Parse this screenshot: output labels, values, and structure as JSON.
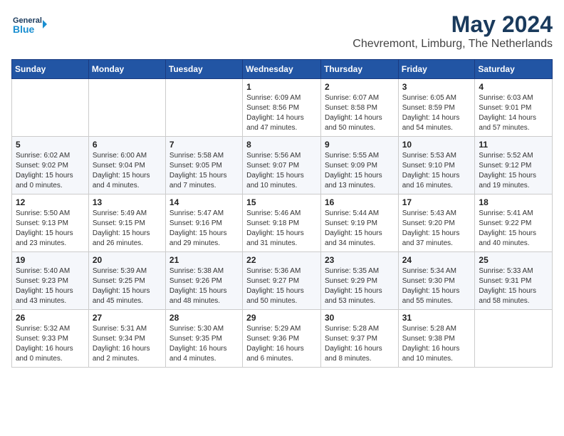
{
  "header": {
    "logo_line1": "General",
    "logo_line2": "Blue",
    "month": "May 2024",
    "location": "Chevremont, Limburg, The Netherlands"
  },
  "weekdays": [
    "Sunday",
    "Monday",
    "Tuesday",
    "Wednesday",
    "Thursday",
    "Friday",
    "Saturday"
  ],
  "weeks": [
    [
      {
        "day": "",
        "detail": ""
      },
      {
        "day": "",
        "detail": ""
      },
      {
        "day": "",
        "detail": ""
      },
      {
        "day": "1",
        "detail": "Sunrise: 6:09 AM\nSunset: 8:56 PM\nDaylight: 14 hours\nand 47 minutes."
      },
      {
        "day": "2",
        "detail": "Sunrise: 6:07 AM\nSunset: 8:58 PM\nDaylight: 14 hours\nand 50 minutes."
      },
      {
        "day": "3",
        "detail": "Sunrise: 6:05 AM\nSunset: 8:59 PM\nDaylight: 14 hours\nand 54 minutes."
      },
      {
        "day": "4",
        "detail": "Sunrise: 6:03 AM\nSunset: 9:01 PM\nDaylight: 14 hours\nand 57 minutes."
      }
    ],
    [
      {
        "day": "5",
        "detail": "Sunrise: 6:02 AM\nSunset: 9:02 PM\nDaylight: 15 hours\nand 0 minutes."
      },
      {
        "day": "6",
        "detail": "Sunrise: 6:00 AM\nSunset: 9:04 PM\nDaylight: 15 hours\nand 4 minutes."
      },
      {
        "day": "7",
        "detail": "Sunrise: 5:58 AM\nSunset: 9:05 PM\nDaylight: 15 hours\nand 7 minutes."
      },
      {
        "day": "8",
        "detail": "Sunrise: 5:56 AM\nSunset: 9:07 PM\nDaylight: 15 hours\nand 10 minutes."
      },
      {
        "day": "9",
        "detail": "Sunrise: 5:55 AM\nSunset: 9:09 PM\nDaylight: 15 hours\nand 13 minutes."
      },
      {
        "day": "10",
        "detail": "Sunrise: 5:53 AM\nSunset: 9:10 PM\nDaylight: 15 hours\nand 16 minutes."
      },
      {
        "day": "11",
        "detail": "Sunrise: 5:52 AM\nSunset: 9:12 PM\nDaylight: 15 hours\nand 19 minutes."
      }
    ],
    [
      {
        "day": "12",
        "detail": "Sunrise: 5:50 AM\nSunset: 9:13 PM\nDaylight: 15 hours\nand 23 minutes."
      },
      {
        "day": "13",
        "detail": "Sunrise: 5:49 AM\nSunset: 9:15 PM\nDaylight: 15 hours\nand 26 minutes."
      },
      {
        "day": "14",
        "detail": "Sunrise: 5:47 AM\nSunset: 9:16 PM\nDaylight: 15 hours\nand 29 minutes."
      },
      {
        "day": "15",
        "detail": "Sunrise: 5:46 AM\nSunset: 9:18 PM\nDaylight: 15 hours\nand 31 minutes."
      },
      {
        "day": "16",
        "detail": "Sunrise: 5:44 AM\nSunset: 9:19 PM\nDaylight: 15 hours\nand 34 minutes."
      },
      {
        "day": "17",
        "detail": "Sunrise: 5:43 AM\nSunset: 9:20 PM\nDaylight: 15 hours\nand 37 minutes."
      },
      {
        "day": "18",
        "detail": "Sunrise: 5:41 AM\nSunset: 9:22 PM\nDaylight: 15 hours\nand 40 minutes."
      }
    ],
    [
      {
        "day": "19",
        "detail": "Sunrise: 5:40 AM\nSunset: 9:23 PM\nDaylight: 15 hours\nand 43 minutes."
      },
      {
        "day": "20",
        "detail": "Sunrise: 5:39 AM\nSunset: 9:25 PM\nDaylight: 15 hours\nand 45 minutes."
      },
      {
        "day": "21",
        "detail": "Sunrise: 5:38 AM\nSunset: 9:26 PM\nDaylight: 15 hours\nand 48 minutes."
      },
      {
        "day": "22",
        "detail": "Sunrise: 5:36 AM\nSunset: 9:27 PM\nDaylight: 15 hours\nand 50 minutes."
      },
      {
        "day": "23",
        "detail": "Sunrise: 5:35 AM\nSunset: 9:29 PM\nDaylight: 15 hours\nand 53 minutes."
      },
      {
        "day": "24",
        "detail": "Sunrise: 5:34 AM\nSunset: 9:30 PM\nDaylight: 15 hours\nand 55 minutes."
      },
      {
        "day": "25",
        "detail": "Sunrise: 5:33 AM\nSunset: 9:31 PM\nDaylight: 15 hours\nand 58 minutes."
      }
    ],
    [
      {
        "day": "26",
        "detail": "Sunrise: 5:32 AM\nSunset: 9:33 PM\nDaylight: 16 hours\nand 0 minutes."
      },
      {
        "day": "27",
        "detail": "Sunrise: 5:31 AM\nSunset: 9:34 PM\nDaylight: 16 hours\nand 2 minutes."
      },
      {
        "day": "28",
        "detail": "Sunrise: 5:30 AM\nSunset: 9:35 PM\nDaylight: 16 hours\nand 4 minutes."
      },
      {
        "day": "29",
        "detail": "Sunrise: 5:29 AM\nSunset: 9:36 PM\nDaylight: 16 hours\nand 6 minutes."
      },
      {
        "day": "30",
        "detail": "Sunrise: 5:28 AM\nSunset: 9:37 PM\nDaylight: 16 hours\nand 8 minutes."
      },
      {
        "day": "31",
        "detail": "Sunrise: 5:28 AM\nSunset: 9:38 PM\nDaylight: 16 hours\nand 10 minutes."
      },
      {
        "day": "",
        "detail": ""
      }
    ]
  ]
}
